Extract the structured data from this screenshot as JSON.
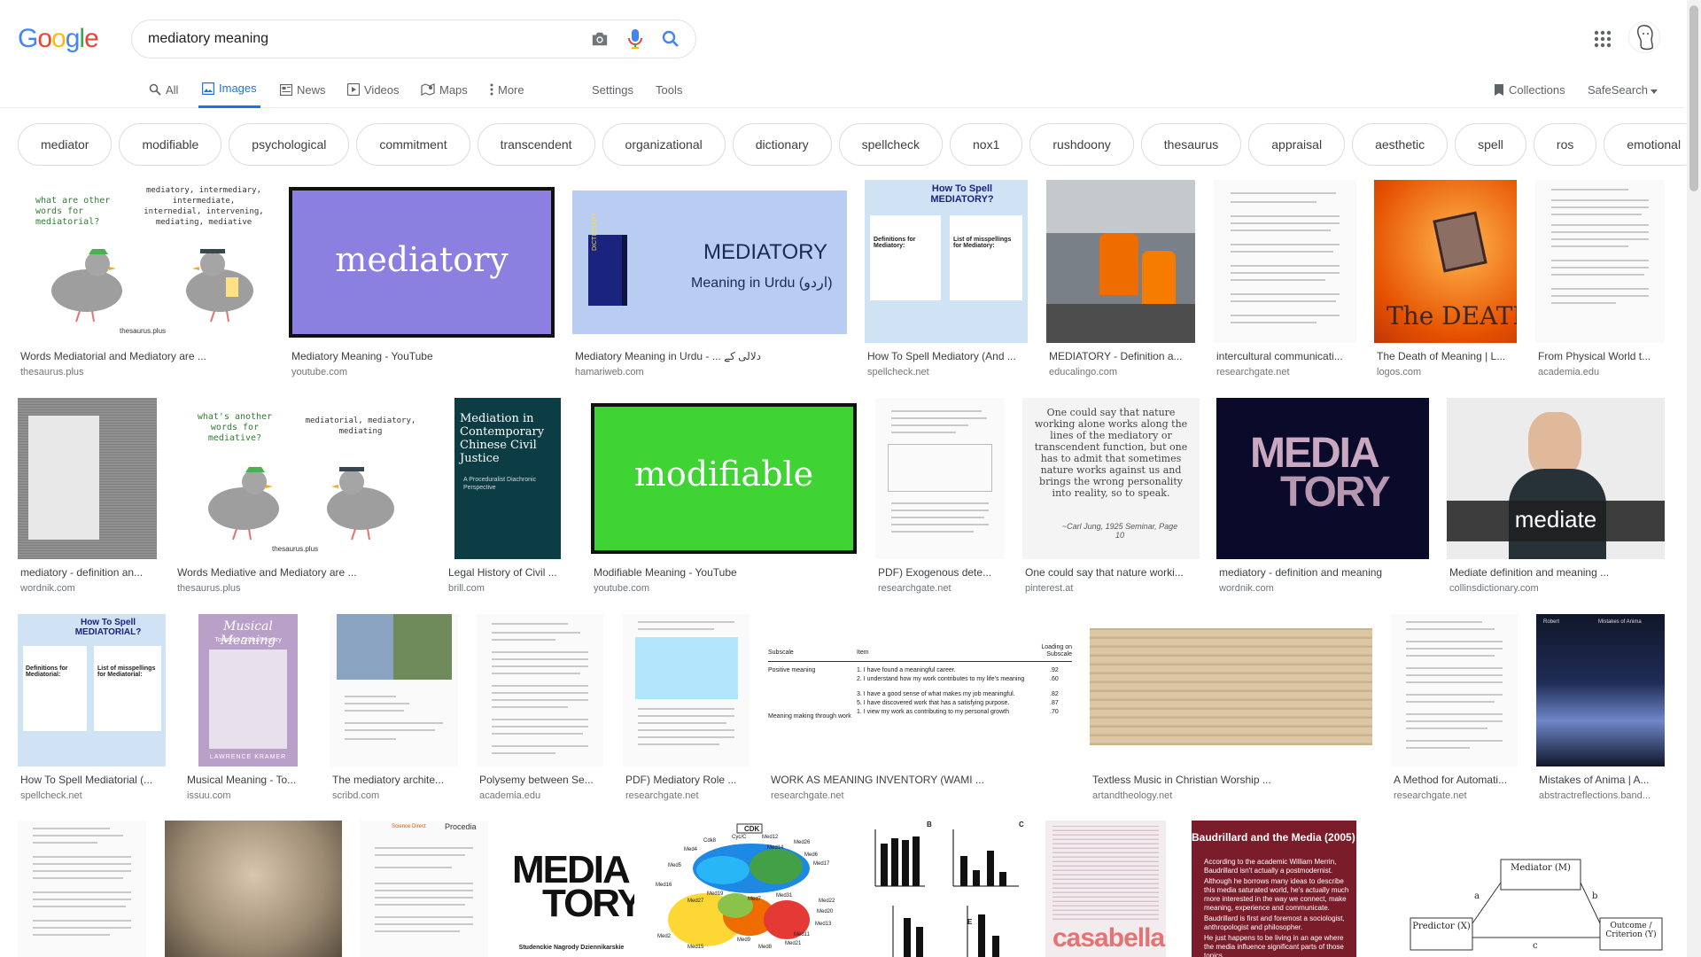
{
  "logo": {
    "letters": [
      "G",
      "o",
      "o",
      "g",
      "l",
      "e"
    ],
    "colors": [
      "#4285f4",
      "#ea4335",
      "#fbbc05",
      "#4285f4",
      "#34a853",
      "#ea4335"
    ]
  },
  "search": {
    "value": "mediatory meaning"
  },
  "tabs": {
    "all": "All",
    "images": "Images",
    "news": "News",
    "videos": "Videos",
    "maps": "Maps",
    "more": "More",
    "settings": "Settings",
    "tools": "Tools",
    "collections": "Collections",
    "safesearch": "SafeSearch"
  },
  "chips": [
    "mediator",
    "modifiable",
    "psychological",
    "commitment",
    "transcendent",
    "organizational",
    "dictionary",
    "spellcheck",
    "nox1",
    "rushdoony",
    "thesaurus",
    "appraisal",
    "aesthetic",
    "spell",
    "ros",
    "emotional"
  ],
  "results": {
    "row1": [
      {
        "title": "Words Mediatorial and Mediatory are ...",
        "source": "thesaurus.plus",
        "thumb_text": [
          "what are other words for mediatorial?",
          "mediatory, intermediary, intermediate, internedial, intervening, mediating, mediative",
          "thesaurus.plus"
        ]
      },
      {
        "title": "Mediatory Meaning - YouTube",
        "source": "youtube.com",
        "thumb_text": [
          "mediatory"
        ]
      },
      {
        "title": "Mediatory Meaning in Urdu - ... دلالی کے",
        "source": "hamariweb.com",
        "thumb_text": [
          "MEDIATORY",
          "Meaning in Urdu (اردو)",
          "DICTIONARY"
        ]
      },
      {
        "title": "How To Spell Mediatory (And ...",
        "source": "spellcheck.net",
        "thumb_text": [
          "How To Spell MEDIATORY?",
          "Definitions for Mediatory:",
          "List of misspellings for Mediatory:"
        ]
      },
      {
        "title": "MEDIATORY - Definition a...",
        "source": "educalingo.com"
      },
      {
        "title": "intercultural communicati...",
        "source": "researchgate.net"
      },
      {
        "title": "The Death of Meaning | L...",
        "source": "logos.com",
        "thumb_text": [
          "The DEATH of"
        ]
      },
      {
        "title": "From Physical World t...",
        "source": "academia.edu"
      }
    ],
    "row2": [
      {
        "title": "mediatory - definition an...",
        "source": "wordnik.com"
      },
      {
        "title": "Words Mediative and Mediatory are ...",
        "source": "thesaurus.plus",
        "thumb_text": [
          "what's another words for mediative?",
          "mediatorial, mediatory, mediating",
          "thesaurus.plus"
        ]
      },
      {
        "title": "Legal History of Civil ...",
        "source": "brill.com",
        "thumb_text": [
          "Mediation in Contemporary Chinese Civil Justice",
          "A Proceduralist Diachronic Perspective"
        ]
      },
      {
        "title": "Modifiable Meaning - YouTube",
        "source": "youtube.com",
        "thumb_text": [
          "modifiable"
        ]
      },
      {
        "title": "PDF) Exogenous dete...",
        "source": "researchgate.net"
      },
      {
        "title": "One could say that nature worki...",
        "source": "pinterest.at",
        "thumb_text": [
          "One could say that nature working alone works along the lines of the mediatory or transcendent function, but one has to admit that sometimes nature works against us and brings the wrong personality into reality, so to speak.",
          "~Carl Jung, 1925 Seminar, Page 10"
        ]
      },
      {
        "title": "mediatory - definition and meaning",
        "source": "wordnik.com",
        "thumb_text": [
          "MEDIA",
          "TORY"
        ]
      },
      {
        "title": "Mediate definition and meaning ...",
        "source": "collinsdictionary.com",
        "thumb_text": [
          "mediate"
        ]
      }
    ],
    "row3": [
      {
        "title": "How To Spell Mediatorial (...",
        "source": "spellcheck.net",
        "thumb_text": [
          "How To Spell MEDIATORIAL?",
          "Definitions for Mediatorial:",
          "List of misspellings for Mediatorial:"
        ]
      },
      {
        "title": "Musical Meaning - To...",
        "source": "issuu.com",
        "thumb_text": [
          "Musical Meaning",
          "Toward a Critical History",
          "LAWRENCE KRAMER"
        ]
      },
      {
        "title": "The mediatory archite...",
        "source": "scribd.com"
      },
      {
        "title": "Polysemy between Se...",
        "source": "academia.edu"
      },
      {
        "title": "PDF) Mediatory Role ...",
        "source": "researchgate.net"
      },
      {
        "title": "WORK AS MEANING INVENTORY (WAMI ...",
        "source": "researchgate.net",
        "thumb_text": [
          "Subscale",
          "Item",
          "Loading on Subscale",
          "Positive meaning",
          "1. I have found a meaningful career.",
          "2. I understand how my work contributes to my life's meaning",
          "3. I have a good sense of what makes my job meaningful.",
          "5. I have discovered work that has a satisfying purpose.",
          "1. I view my work as contributing to my personal growth",
          "Meaning making through work",
          ".92",
          ".60",
          ".82",
          ".87",
          ".70"
        ]
      },
      {
        "title": "Textless Music in Christian Worship ...",
        "source": "artandtheology.net"
      },
      {
        "title": "A Method for Automati...",
        "source": "researchgate.net"
      },
      {
        "title": "Mistakes of Anima | A...",
        "source": "abstractreflections.band...",
        "thumb_text": [
          "Robert",
          "Mistakes of Anima"
        ]
      }
    ],
    "row4": [
      {
        "title": "",
        "source": ""
      },
      {
        "title": "",
        "source": ""
      },
      {
        "title": "",
        "source": "",
        "thumb_text": [
          "Science Direct",
          "Procedia"
        ]
      },
      {
        "title": "",
        "source": "",
        "thumb_text": [
          "MEDIA",
          "TORY",
          "Studenckie Nagrody Dziennikarskie"
        ]
      },
      {
        "title": "",
        "source": "",
        "thumb_text": [
          "CDK",
          "Cdk8",
          "Cyc/C",
          "Med12",
          "Med26",
          "Med4",
          "Med6",
          "Med17",
          "Med16",
          "Med5",
          "Med22",
          "Med20",
          "Med13",
          "Med9",
          "Med21",
          "Med2",
          "Med15",
          "Med8",
          "Med11",
          "Med14",
          "Med7",
          "Med31",
          "Med27",
          "Med19"
        ]
      },
      {
        "title": "",
        "source": "",
        "thumb_text": [
          "B",
          "C",
          "E"
        ]
      },
      {
        "title": "",
        "source": "",
        "thumb_text": [
          "casabella"
        ]
      },
      {
        "title": "",
        "source": "",
        "thumb_text": [
          "Baudrillard and the Media (2005)",
          "According to the academic William Merrin, Baudrillard isn't actually a postmodernist.",
          "Although he borrows many ideas to describe this media saturated world, he's actually much more interested in the way we connect, make meaning, experience and communicate.",
          "Baudrillard is first and foremost a sociologist, anthropologist and philosopher.",
          "He just happens to be living in an age where the media influence significant parts of those topics."
        ]
      },
      {
        "title": "",
        "source": "",
        "thumb_text": [
          "Mediator (M)",
          "Predictor (X)",
          "Outcome / Criterion (Y)",
          "a",
          "b",
          "c"
        ]
      }
    ]
  }
}
